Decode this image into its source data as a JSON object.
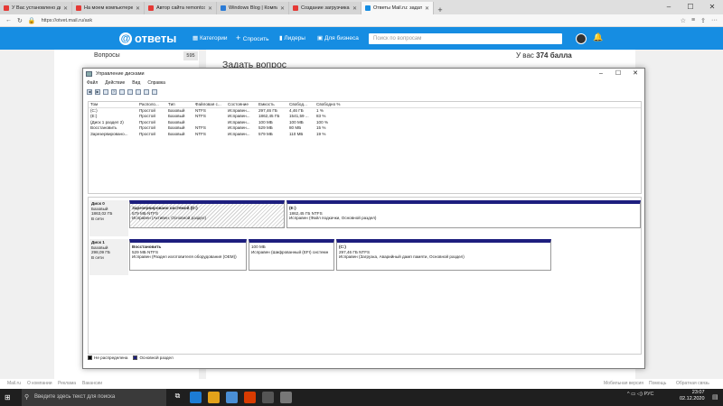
{
  "browser": {
    "tabs": [
      {
        "label": "У Вас установлено две опе",
        "color": "#e53935",
        "active": false
      },
      {
        "label": "На моем компьютере был",
        "color": "#e53935",
        "active": false
      },
      {
        "label": "Автор сайта remontcompa",
        "color": "#e53935",
        "active": false
      },
      {
        "label": "Windows Blog | Компьютер",
        "color": "#2b7bd6",
        "active": false
      },
      {
        "label": "Создание загрузчика Wind",
        "color": "#e53935",
        "active": false
      },
      {
        "label": "Ответы Mail.ru: задать",
        "color": "#168de2",
        "active": true
      }
    ],
    "url": "https://otvet.mail.ru/ask"
  },
  "site": {
    "logo": "ответы",
    "nav": {
      "categories": "Категории",
      "ask": "Спросить",
      "leaders": "Лидеры",
      "business": "Для бизнеса"
    },
    "search_placeholder": "Поиск по вопросам",
    "questions_label": "Вопросы",
    "questions_count": "595",
    "ask_title": "Задать вопрос",
    "score_prefix": "У вас",
    "score_value": "374 балла"
  },
  "dialog": {
    "title": "Управление дисками",
    "menu": [
      "Файл",
      "Действие",
      "Вид",
      "Справка"
    ],
    "columns": [
      "Том",
      "Располо...",
      "Тип",
      "Файловая с...",
      "Состояние",
      "Емкость",
      "Свобод...",
      "Свободно %"
    ],
    "rows": [
      [
        "(C:)",
        "Простой",
        "Базовый",
        "NTFS",
        "Исправен...",
        "297,46 ГБ",
        "4,46 ГБ",
        "1 %"
      ],
      [
        "(E:)",
        "Простой",
        "Базовый",
        "NTFS",
        "Исправен...",
        "1862,45 ГБ",
        "1541,59 ...",
        "83 %"
      ],
      [
        "(Диск 1 раздел 2)",
        "Простой",
        "Базовый",
        "",
        "Исправен...",
        "100 МБ",
        "100 МБ",
        "100 %"
      ],
      [
        "Восстановить",
        "Простой",
        "Базовый",
        "NTFS",
        "Исправен...",
        "529 МБ",
        "80 МБ",
        "15 %"
      ],
      [
        "Зарезервировано...",
        "Простой",
        "Базовый",
        "NTFS",
        "Исправен...",
        "579 МБ",
        "110 МБ",
        "19 %"
      ]
    ],
    "disk0": {
      "name": "Диск 0",
      "type": "Базовый",
      "size": "1863,02 ГБ",
      "status": "В сети",
      "parts": [
        {
          "title": "Зарезервировано системой (D:)",
          "size": "579 МБ NTFS",
          "status": "Исправен (Активен, Основной раздел)"
        },
        {
          "title": "(E:)",
          "size": "1862,45 ГБ NTFS",
          "status": "Исправен (Файл подкачки, Основной раздел)"
        }
      ]
    },
    "disk1": {
      "name": "Диск 1",
      "type": "Базовый",
      "size": "298,09 ГБ",
      "status": "В сети",
      "parts": [
        {
          "title": "Восстановить",
          "size": "529 МБ NTFS",
          "status": "Исправен (Раздел изготовителя оборудования (OEM))"
        },
        {
          "title": "",
          "size": "100 МБ",
          "status": "Исправен (Шифрованный (EFI) системн"
        },
        {
          "title": "(C:)",
          "size": "297,46 ГБ NTFS",
          "status": "Исправен (Загрузка, Аварийный дамп памяти, Основной раздел)"
        }
      ]
    },
    "legend": {
      "unallocated": "Не распределена",
      "primary": "Основной раздел",
      "unallocated_color": "#000000",
      "primary_color": "#1d1e7e"
    }
  },
  "footer": {
    "left": [
      "Mail.ru",
      "О компании",
      "Реклама",
      "Вакансии"
    ],
    "right": [
      "Мобильная версия",
      "Помощь",
      "Обратная связь"
    ]
  },
  "taskbar": {
    "search": "Введите здесь текст для поиска",
    "lang": "РУС",
    "time": "23:07",
    "date": "02.12.2020"
  }
}
